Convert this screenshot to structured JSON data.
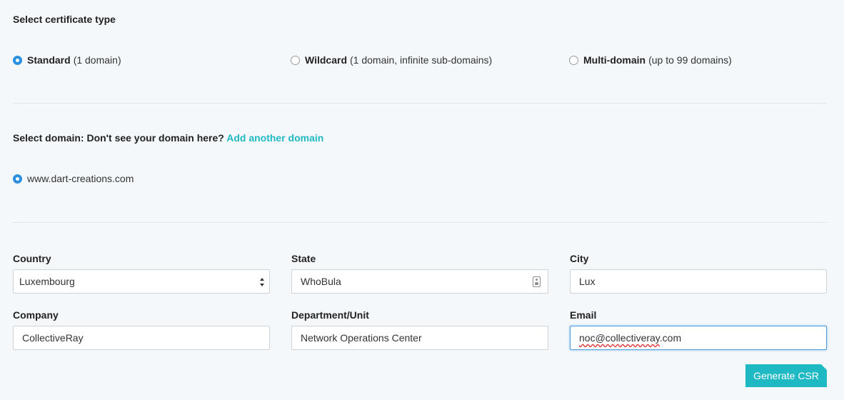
{
  "cert_type": {
    "title": "Select certificate type",
    "options": [
      {
        "name": "Standard",
        "detail": "(1 domain)",
        "checked": true
      },
      {
        "name": "Wildcard",
        "detail": "(1 domain, infinite sub-domains)",
        "checked": false
      },
      {
        "name": "Multi-domain",
        "detail": "(up to 99 domains)",
        "checked": false
      }
    ]
  },
  "domain": {
    "title": "Select domain: Don't see your domain here?",
    "add_link": "Add another domain",
    "options": [
      {
        "label": "www.dart-creations.com",
        "checked": true
      }
    ]
  },
  "form": {
    "country": {
      "label": "Country",
      "value": "Luxembourg"
    },
    "state": {
      "label": "State",
      "value": "WhoBula"
    },
    "city": {
      "label": "City",
      "value": "Lux"
    },
    "company": {
      "label": "Company",
      "value": "CollectiveRay"
    },
    "department": {
      "label": "Department/Unit",
      "value": "Network Operations Center"
    },
    "email": {
      "label": "Email",
      "value": "noc@collectiveray.com",
      "value_misspelled": "noc@collectiveray",
      "value_rest": ".com"
    }
  },
  "actions": {
    "generate_label": "Generate CSR"
  },
  "colors": {
    "accent": "#1fb9c4",
    "radio_checked": "#2d8fe0",
    "background": "#f5f8fa"
  }
}
